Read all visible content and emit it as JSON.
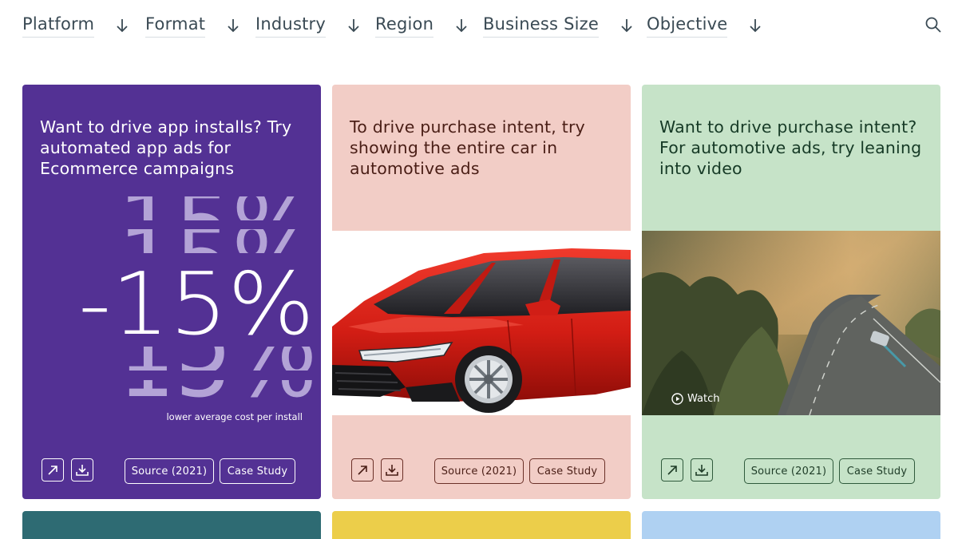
{
  "filters": [
    {
      "label": "Platform"
    },
    {
      "label": "Format"
    },
    {
      "label": "Industry"
    },
    {
      "label": "Region"
    },
    {
      "label": "Business Size"
    },
    {
      "label": "Objective"
    }
  ],
  "search": {
    "icon": "search-icon"
  },
  "cards": [
    {
      "title": "Want to drive app installs? Try automated app ads for Ecommerce campaigns",
      "stat": "-15%",
      "stat_caption": "lower average cost per install",
      "source_label": "Source (2021)",
      "case_label": "Case Study",
      "bg": "#533194"
    },
    {
      "title": "To drive purchase intent, try showing the entire car in automotive ads",
      "source_label": "Source (2021)",
      "case_label": "Case Study",
      "bg": "#f2cdc6"
    },
    {
      "title": "Want to drive purchase intent? For automotive ads, try leaning into video",
      "watch_label": "Watch",
      "source_label": "Source (2021)",
      "case_label": "Case Study",
      "bg": "#c6e3c8"
    }
  ],
  "colors": {
    "purple": "#533194",
    "pink": "#f2cdc6",
    "green": "#c6e3c8",
    "teal": "#2e6b73",
    "yellow": "#ecce4a",
    "blue": "#afd1f2"
  }
}
